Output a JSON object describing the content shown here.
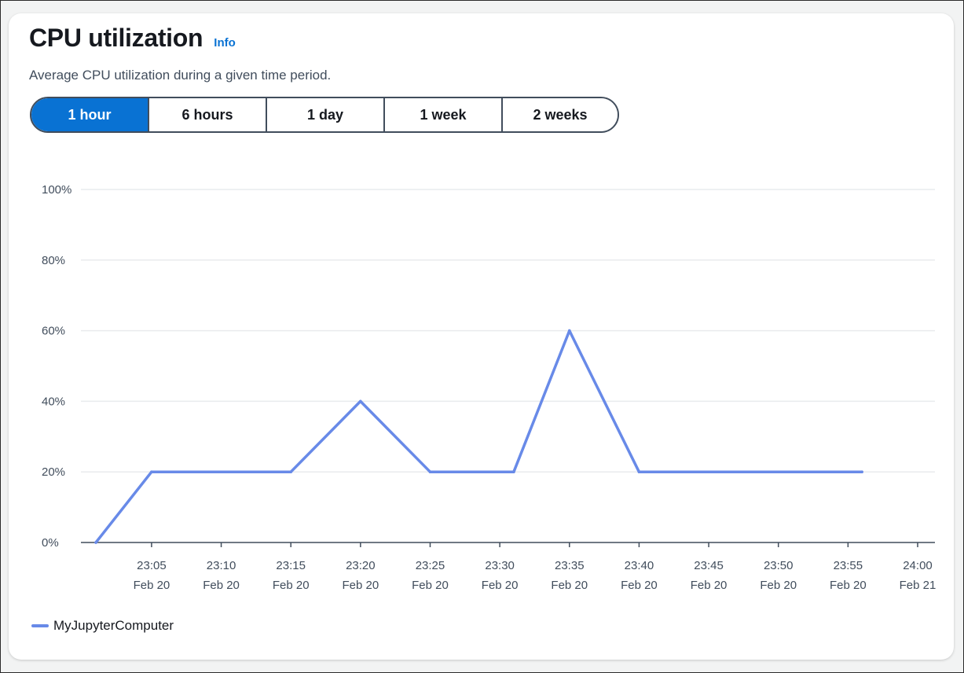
{
  "card": {
    "title": "CPU utilization",
    "info_label": "Info",
    "subtitle": "Average CPU utilization during a given time period."
  },
  "range_selector": {
    "options": [
      "1 hour",
      "6 hours",
      "1 day",
      "1 week",
      "2 weeks"
    ],
    "selected": "1 hour"
  },
  "colors": {
    "accent": "#0972d3",
    "series": "#688ae8",
    "grid": "#e9ebed",
    "axis": "#414d5c"
  },
  "chart_data": {
    "type": "line",
    "title": "",
    "xlabel": "",
    "ylabel": "",
    "ylim": [
      0,
      100
    ],
    "y_ticks": [
      "0%",
      "20%",
      "40%",
      "60%",
      "80%",
      "100%"
    ],
    "y_tick_values": [
      0,
      20,
      40,
      60,
      80,
      100
    ],
    "x_range": [
      "23:01",
      "24:00"
    ],
    "x_ticks": [
      {
        "time": "23:05",
        "date": "Feb 20"
      },
      {
        "time": "23:10",
        "date": "Feb 20"
      },
      {
        "time": "23:15",
        "date": "Feb 20"
      },
      {
        "time": "23:20",
        "date": "Feb 20"
      },
      {
        "time": "23:25",
        "date": "Feb 20"
      },
      {
        "time": "23:30",
        "date": "Feb 20"
      },
      {
        "time": "23:35",
        "date": "Feb 20"
      },
      {
        "time": "23:40",
        "date": "Feb 20"
      },
      {
        "time": "23:45",
        "date": "Feb 20"
      },
      {
        "time": "23:50",
        "date": "Feb 20"
      },
      {
        "time": "23:55",
        "date": "Feb 20"
      },
      {
        "time": "24:00",
        "date": "Feb 21"
      }
    ],
    "grid": true,
    "legend_position": "bottom-left",
    "series": [
      {
        "name": "MyJupyterComputer",
        "x": [
          "23:01",
          "23:05",
          "23:15",
          "23:20",
          "23:25",
          "23:31",
          "23:35",
          "23:40",
          "23:56"
        ],
        "values": [
          0,
          20,
          20,
          40,
          20,
          20,
          60,
          20,
          20
        ]
      }
    ]
  }
}
